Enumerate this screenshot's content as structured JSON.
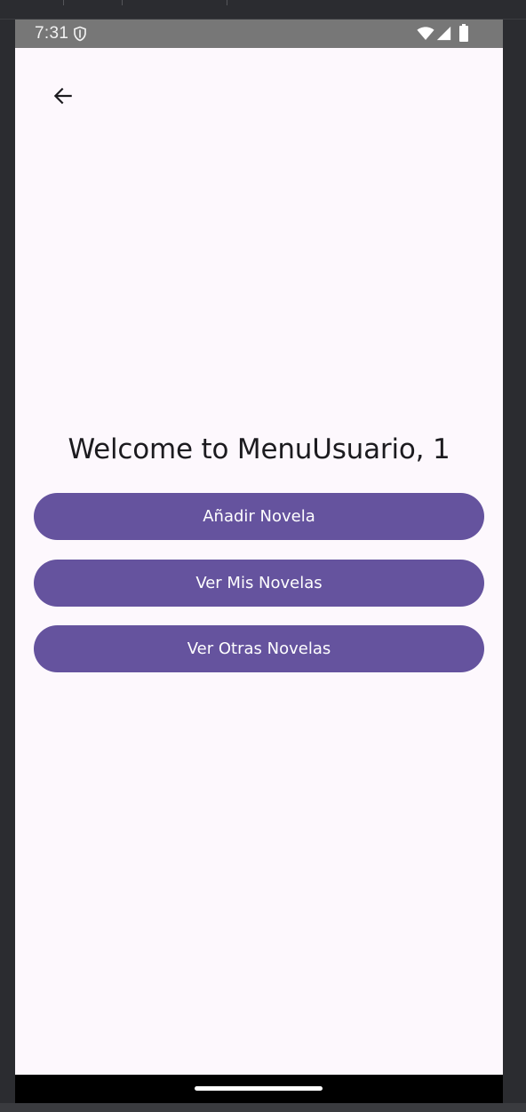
{
  "status_bar": {
    "time": "7:31"
  },
  "header": {
    "back_icon": "arrow-left-icon"
  },
  "main": {
    "title": "Welcome to MenuUsuario, 1",
    "buttons": [
      {
        "label": "Añadir Novela"
      },
      {
        "label": "Ver Mis Novelas"
      },
      {
        "label": "Ver Otras Novelas"
      }
    ]
  },
  "colors": {
    "accent": "#65539e",
    "background": "#fdf8fd",
    "status_bar": "#777777",
    "nav_bar": "#000000"
  }
}
